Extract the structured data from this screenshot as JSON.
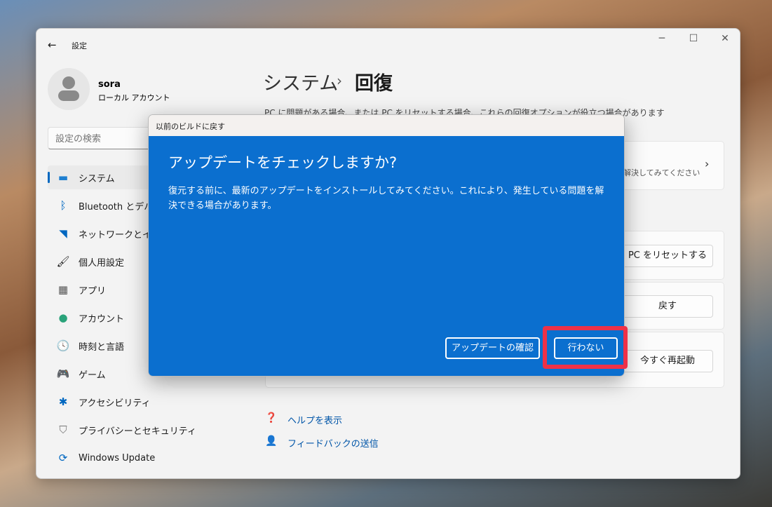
{
  "window": {
    "title": "設定",
    "back": "←",
    "min": "─",
    "max": "☐",
    "close": "✕"
  },
  "user": {
    "name": "sora",
    "type": "ローカル アカウント"
  },
  "search": {
    "placeholder": "設定の検索"
  },
  "sidebar": {
    "items": [
      {
        "label": "システム",
        "icon": "display-icon"
      },
      {
        "label": "Bluetooth とデバイス",
        "icon": "bluetooth-icon"
      },
      {
        "label": "ネットワークとインターネット",
        "icon": "wifi-icon"
      },
      {
        "label": "個人用設定",
        "icon": "brush-icon"
      },
      {
        "label": "アプリ",
        "icon": "apps-icon"
      },
      {
        "label": "アカウント",
        "icon": "account-icon"
      },
      {
        "label": "時刻と言語",
        "icon": "clock-globe-icon"
      },
      {
        "label": "ゲーム",
        "icon": "gamepad-icon"
      },
      {
        "label": "アクセシビリティ",
        "icon": "accessibility-icon"
      },
      {
        "label": "プライバシーとセキュリティ",
        "icon": "shield-icon"
      },
      {
        "label": "Windows Update",
        "icon": "update-icon"
      }
    ]
  },
  "main": {
    "breadcrumb_parent": "システム",
    "separator": "›",
    "title": "回復",
    "description": "PC に問題がある場合、または PC をリセットする場合、これらの回復オプションが役立つ場合があります",
    "card1_sub": "解決してみてください",
    "reset_button": "PC をリセットする",
    "goback_button": "戻す",
    "restart_button": "今すぐ再起動",
    "help_link": "ヘルプを表示",
    "feedback_link": "フィードバックの送信"
  },
  "dialog": {
    "title": "以前のビルドに戻す",
    "heading": "アップデートをチェックしますか?",
    "body": "復元する前に、最新のアップデートをインストールしてみてください。これにより、発生している問題を解決できる場合があります。",
    "check_button": "アップデートの確認",
    "no_button": "行わない"
  },
  "colors": {
    "accent": "#0067c0",
    "dialog": "#0b6fcf",
    "highlight": "#ee3148"
  }
}
